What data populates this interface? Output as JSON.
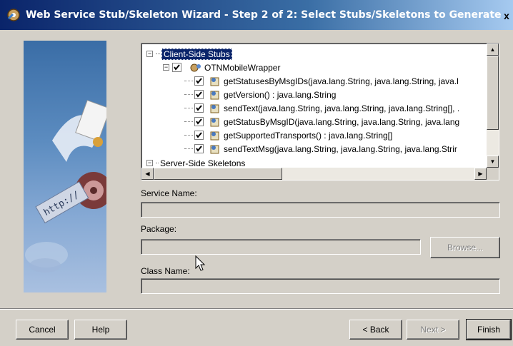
{
  "window": {
    "title": "Web Service Stub/Skeleton Wizard - Step 2 of 2: Select Stubs/Skeletons to Generate",
    "close_label": "x"
  },
  "tree": {
    "client_root": "Client-Side Stubs",
    "service_node": "OTNMobileWrapper",
    "methods": [
      "getStatusesByMsgIDs(java.lang.String, java.lang.String, java.l",
      "getVersion() : java.lang.String",
      "sendText(java.lang.String, java.lang.String, java.lang.String[], .",
      "getStatusByMsgID(java.lang.String, java.lang.String, java.lang",
      "getSupportedTransports() : java.lang.String[]",
      "sendTextMsg(java.lang.String, java.lang.String, java.lang.Strir"
    ],
    "server_root": "Server-Side Skeletons"
  },
  "form": {
    "service_name_label": "Service Name:",
    "service_name_value": "",
    "package_label": "Package:",
    "package_value": "",
    "class_name_label": "Class Name:",
    "class_name_value": "",
    "browse_label": "Browse..."
  },
  "footer": {
    "cancel": "Cancel",
    "help": "Help",
    "back": "< Back",
    "next": "Next >",
    "finish": "Finish"
  },
  "colors": {
    "title_start": "#0a246a",
    "title_end": "#a6caf0",
    "face": "#d4d0c8",
    "selection": "#0a246a"
  },
  "icons": {
    "title": "wizard-gear-icon",
    "service": "web-service-icon",
    "method": "method-icon"
  }
}
